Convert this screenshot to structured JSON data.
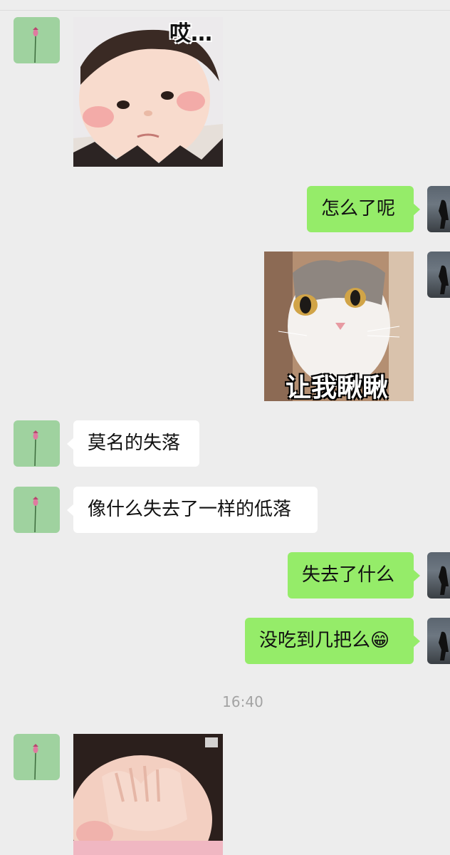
{
  "timestamp": "16:40",
  "messages": [
    {
      "side": "left",
      "type": "sticker",
      "caption": "哎…",
      "icon": "baby-sticker"
    },
    {
      "side": "right",
      "type": "text",
      "text": "怎么了呢"
    },
    {
      "side": "right",
      "type": "sticker",
      "caption": "让我瞅瞅",
      "icon": "cat-sticker"
    },
    {
      "side": "left",
      "type": "text",
      "text": "莫名的失落"
    },
    {
      "side": "left",
      "type": "text",
      "text": "像什么失去了一样的低落"
    },
    {
      "side": "right",
      "type": "text",
      "text": "失去了什么"
    },
    {
      "side": "right",
      "type": "text",
      "text": "没吃到几把么😁"
    },
    {
      "side": "left",
      "type": "sticker",
      "caption": "",
      "icon": "baby-covering-face-sticker"
    }
  ],
  "colors": {
    "background": "#ededed",
    "bubble_left": "#ffffff",
    "bubble_right": "#95ec69",
    "avatar_left": "#9fd29f"
  }
}
